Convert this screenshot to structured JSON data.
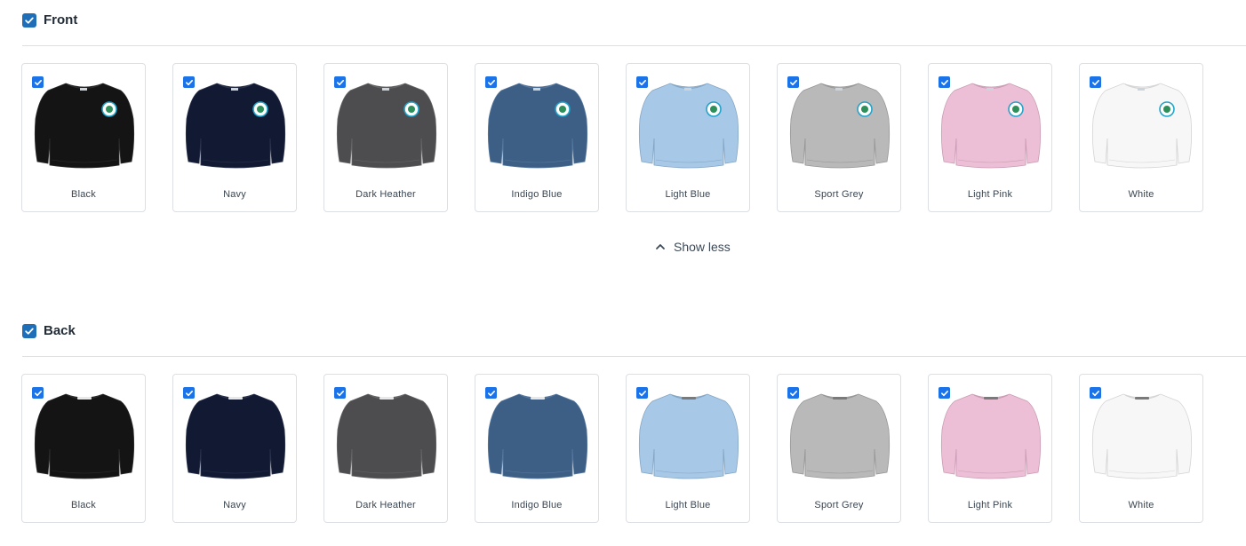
{
  "sections": {
    "front": {
      "title": "Front",
      "checked": true,
      "variants": [
        {
          "label": "Black",
          "color": "#141414"
        },
        {
          "label": "Navy",
          "color": "#121a33"
        },
        {
          "label": "Dark Heather",
          "color": "#4d4d4f"
        },
        {
          "label": "Indigo Blue",
          "color": "#3d5f86"
        },
        {
          "label": "Light Blue",
          "color": "#a7c8e6"
        },
        {
          "label": "Sport Grey",
          "color": "#b9b9ba"
        },
        {
          "label": "Light Pink",
          "color": "#edbfd7"
        },
        {
          "label": "White",
          "color": "#f7f7f7"
        }
      ]
    },
    "back": {
      "title": "Back",
      "checked": true,
      "variants": [
        {
          "label": "Black",
          "color": "#141414"
        },
        {
          "label": "Navy",
          "color": "#121a33"
        },
        {
          "label": "Dark Heather",
          "color": "#4d4d4f"
        },
        {
          "label": "Indigo Blue",
          "color": "#3d5f86"
        },
        {
          "label": "Light Blue",
          "color": "#a7c8e6"
        },
        {
          "label": "Sport Grey",
          "color": "#b9b9ba"
        },
        {
          "label": "Light Pink",
          "color": "#edbfd7"
        },
        {
          "label": "White",
          "color": "#f7f7f7"
        }
      ]
    }
  },
  "show_less": {
    "label": "Show less",
    "icon": "chevron-up-icon"
  },
  "colors": {
    "accent": "#1e6fb8",
    "checkbox": "#1a73e8"
  }
}
